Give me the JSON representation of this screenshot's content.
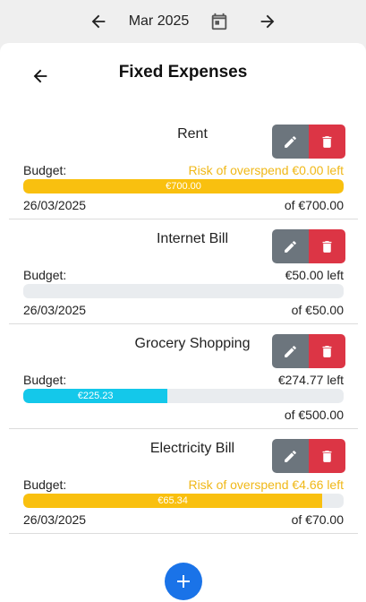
{
  "topbar": {
    "month": "Mar 2025"
  },
  "sheet": {
    "title": "Fixed Expenses"
  },
  "expenses": [
    {
      "name": "Rent",
      "budget_label": "Budget:",
      "status": "Risk of overspend €0.00 left",
      "warn": true,
      "progress_fraction": 1.0,
      "bar_label": "€700.00",
      "bar_color": "#f9c00f",
      "date": "26/03/2025",
      "of": "of €700.00"
    },
    {
      "name": "Internet Bill",
      "budget_label": "Budget:",
      "status": "€50.00 left",
      "warn": false,
      "progress_fraction": 0.0,
      "bar_label": "",
      "bar_color": "#f9c00f",
      "date": "26/03/2025",
      "of": "of €50.00"
    },
    {
      "name": "Grocery Shopping",
      "budget_label": "Budget:",
      "status": "€274.77 left",
      "warn": false,
      "progress_fraction": 0.4505,
      "bar_label": "€225.23",
      "bar_color": "#14c8ea",
      "date": "",
      "of": "of €500.00"
    },
    {
      "name": "Electricity Bill",
      "budget_label": "Budget:",
      "status": "Risk of overspend €4.66 left",
      "warn": true,
      "progress_fraction": 0.9334,
      "bar_label": "€65.34",
      "bar_color": "#f9c00f",
      "date": "26/03/2025",
      "of": "of €70.00"
    }
  ],
  "colors": {
    "edit": "#6c757d",
    "delete": "#dc3545",
    "fab": "#1a73e8",
    "warn_text": "#f0b818"
  },
  "icons": {
    "prev": "arrow-left-icon",
    "next": "arrow-right-icon",
    "calendar": "calendar-icon",
    "edit": "pencil-icon",
    "delete": "trash-icon",
    "add": "plus-icon"
  }
}
